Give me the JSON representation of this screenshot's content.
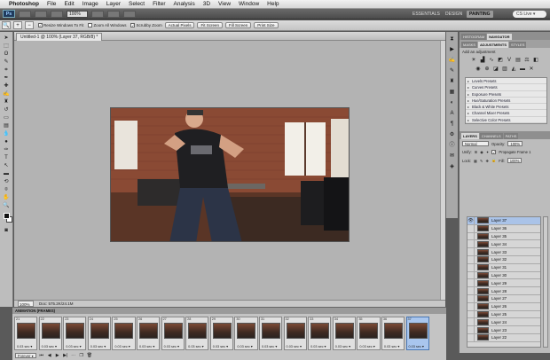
{
  "menubar": {
    "app": "Photoshop",
    "items": [
      "File",
      "Edit",
      "Image",
      "Layer",
      "Select",
      "Filter",
      "Analysis",
      "3D",
      "View",
      "Window",
      "Help"
    ],
    "right": "CS Live ▾"
  },
  "appbar": {
    "zoom": "100%",
    "workspaces": [
      {
        "label": "ESSENTIALS",
        "active": false
      },
      {
        "label": "DESIGN",
        "active": false
      },
      {
        "label": "PAINTING",
        "active": true
      }
    ],
    "search": "CS Live"
  },
  "options": {
    "checks": [
      {
        "label": "Resize Windows To Fit",
        "checked": true
      },
      {
        "label": "Zoom All Windows",
        "checked": false
      },
      {
        "label": "Scrubby Zoom",
        "checked": true
      }
    ],
    "buttons": [
      "Actual Pixels",
      "Fit Screen",
      "Fill Screen",
      "Print Size"
    ]
  },
  "document": {
    "tab": "Untitled-1 @ 100% (Layer 37, RGB/8) *",
    "zoom": "100%",
    "doc_size": "Doc: 575.2K/24.1M"
  },
  "panels": {
    "top_tabs": [
      "HISTOGRAM",
      "NAVIGATOR"
    ],
    "mid_tabs": [
      "MASKS",
      "ADJUSTMENTS",
      "STYLES"
    ],
    "adj_heading": "Add an adjustment",
    "presets": [
      "Levels Presets",
      "Curves Presets",
      "Exposure Presets",
      "Hue/Saturation Presets",
      "Black & White Presets",
      "Channel Mixer Presets",
      "Selective Color Presets"
    ],
    "layer_tabs": [
      "LAYERS",
      "CHANNELS",
      "PATHS"
    ],
    "blend_mode": "Normal",
    "opacity_label": "Opacity:",
    "opacity": "100%",
    "unify_label": "Unify:",
    "propagate": "Propagate Frame 1",
    "lock_label": "Lock:",
    "fill_label": "Fill:",
    "fill": "100%",
    "layers": [
      "Layer 37",
      "Layer 36",
      "Layer 35",
      "Layer 34",
      "Layer 33",
      "Layer 32",
      "Layer 31",
      "Layer 30",
      "Layer 29",
      "Layer 28",
      "Layer 27",
      "Layer 26",
      "Layer 25",
      "Layer 24",
      "Layer 23",
      "Layer 22"
    ]
  },
  "animation": {
    "tab": "ANIMATION (FRAMES)",
    "frames": [
      {
        "n": "21",
        "delay": "0.03 sec ▾"
      },
      {
        "n": "22",
        "delay": "0.03 sec ▾"
      },
      {
        "n": "23",
        "delay": "0.03 sec ▾"
      },
      {
        "n": "24",
        "delay": "0.03 sec ▾"
      },
      {
        "n": "25",
        "delay": "0.03 sec ▾"
      },
      {
        "n": "26",
        "delay": "0.03 sec ▾"
      },
      {
        "n": "27",
        "delay": "0.03 sec ▾"
      },
      {
        "n": "28",
        "delay": "0.03 sec ▾"
      },
      {
        "n": "29",
        "delay": "0.03 sec ▾"
      },
      {
        "n": "30",
        "delay": "0.03 sec ▾"
      },
      {
        "n": "31",
        "delay": "0.03 sec ▾"
      },
      {
        "n": "32",
        "delay": "0.03 sec ▾"
      },
      {
        "n": "33",
        "delay": "0.03 sec ▾"
      },
      {
        "n": "34",
        "delay": "0.03 sec ▾"
      },
      {
        "n": "35",
        "delay": "0.03 sec ▾"
      },
      {
        "n": "36",
        "delay": "0.03 sec ▾"
      },
      {
        "n": "37",
        "delay": "0.03 sec ▾"
      }
    ],
    "loop": "Forever ▾"
  }
}
